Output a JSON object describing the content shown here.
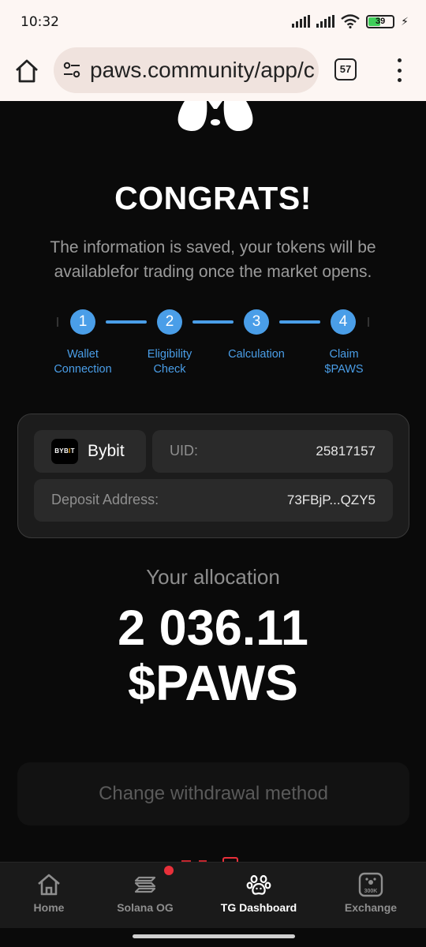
{
  "status_bar": {
    "time": "10:32",
    "battery_level": "39",
    "icons": [
      "signal-icon",
      "signal-icon",
      "wifi-icon",
      "battery-icon",
      "charging-icon"
    ]
  },
  "browser": {
    "url": "paws.community/app/c",
    "tab_count": "57",
    "icons": [
      "home-icon",
      "site-settings-icon",
      "tabs-icon",
      "more-menu-icon"
    ]
  },
  "header": {
    "title": "CONGRATS!",
    "subtitle": "The information is saved, your tokens will be availablefor trading once the market opens."
  },
  "steps": [
    {
      "number": "1",
      "label": "Wallet Connection"
    },
    {
      "number": "2",
      "label": "Eligibility Check"
    },
    {
      "number": "3",
      "label": "Calculation"
    },
    {
      "number": "4",
      "label": "Claim $PAWS"
    }
  ],
  "exchange_card": {
    "logo_text_a": "BYB",
    "logo_text_b": "I",
    "logo_text_c": "T",
    "exchange_name": "Bybit",
    "uid_label": "UID:",
    "uid_value": "25817157",
    "address_label": "Deposit Address:",
    "address_value": "73FBjP...QZY5"
  },
  "allocation": {
    "label": "Your allocation",
    "amount": "2 036.11",
    "token": "$PAWS"
  },
  "actions": {
    "change_withdrawal": "Change withdrawal method"
  },
  "bottom_nav": {
    "items": [
      {
        "label": "Home",
        "icon": "home-icon"
      },
      {
        "label": "Solana OG",
        "icon": "solana-icon",
        "badge": true
      },
      {
        "label": "TG Dashboard",
        "icon": "paw-icon",
        "active": true
      },
      {
        "label": "Exchange",
        "icon": "exchange-icon",
        "icon_text": "300K"
      }
    ]
  },
  "colors": {
    "accent_blue": "#4a9ee8",
    "background": "#0a0a0a",
    "badge_red": "#e8303a",
    "bybit_orange": "#f7a600"
  }
}
